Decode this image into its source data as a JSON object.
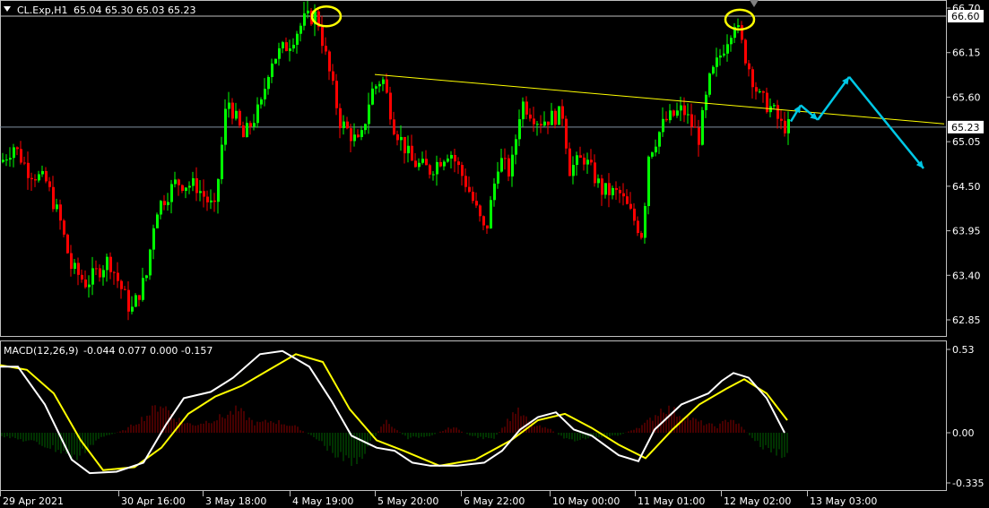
{
  "header": {
    "symbol": "CL.Exp,H1",
    "ohlc": "65.04 65.30 65.03 65.23"
  },
  "macd_header": {
    "label": "MACD(12,26,9)",
    "values": "-0.044 0.077 0.000 -0.157"
  },
  "price_axis": {
    "ticks": [
      "66.70",
      "66.15",
      "65.60",
      "65.05",
      "64.50",
      "63.95",
      "63.40",
      "62.85"
    ],
    "tick_values": [
      66.7,
      66.15,
      65.6,
      65.05,
      64.5,
      63.95,
      63.4,
      62.85
    ],
    "current_price": "65.23",
    "resistance_price": "66.60",
    "resistance_value": 66.6,
    "current_value": 65.23
  },
  "macd_axis": {
    "ticks": [
      "0.53",
      "0.00",
      "-0.335"
    ],
    "tick_values": [
      0.53,
      0.0,
      -0.335
    ]
  },
  "time_axis": {
    "labels": [
      "29 Apr 2021",
      "30 Apr 16:00",
      "3 May 18:00",
      "4 May 19:00",
      "5 May 20:00",
      "6 May 22:00",
      "10 May 00:00",
      "11 May 01:00",
      "12 May 02:00",
      "13 May 03:00"
    ]
  },
  "colors": {
    "background": "#000000",
    "bull": "#00ff00",
    "bear": "#ff0000",
    "grid_line": "#c0c0c0",
    "trendline": "#ffff00",
    "macd_line": "#ffffff",
    "signal_line": "#ffff00",
    "histogram_pos": "#8b0000",
    "histogram_neg": "#006400",
    "annotation_arrow": "#00c8e6",
    "circle": "#ffff00",
    "tag_bg": "#ffffff",
    "tag_text": "#000000"
  },
  "chart_data": {
    "type": "candlestick",
    "timeframe": "H1",
    "price_path": [
      [
        0,
        64.8
      ],
      [
        14,
        65.0
      ],
      [
        30,
        64.7
      ],
      [
        50,
        64.55
      ],
      [
        65,
        64.1
      ],
      [
        78,
        63.5
      ],
      [
        95,
        63.3
      ],
      [
        120,
        63.6
      ],
      [
        145,
        62.95
      ],
      [
        162,
        63.4
      ],
      [
        172,
        64.2
      ],
      [
        195,
        64.55
      ],
      [
        218,
        64.5
      ],
      [
        238,
        64.2
      ],
      [
        252,
        65.6
      ],
      [
        270,
        65.1
      ],
      [
        290,
        65.5
      ],
      [
        300,
        66.05
      ],
      [
        320,
        66.25
      ],
      [
        338,
        66.55
      ],
      [
        352,
        66.62
      ],
      [
        362,
        66.1
      ],
      [
        378,
        65.3
      ],
      [
        400,
        65.0
      ],
      [
        412,
        65.65
      ],
      [
        425,
        65.85
      ],
      [
        438,
        65.25
      ],
      [
        458,
        64.8
      ],
      [
        478,
        64.7
      ],
      [
        500,
        64.95
      ],
      [
        520,
        64.5
      ],
      [
        540,
        63.9
      ],
      [
        555,
        64.85
      ],
      [
        568,
        64.65
      ],
      [
        580,
        65.55
      ],
      [
        600,
        65.3
      ],
      [
        628,
        65.4
      ],
      [
        632,
        64.7
      ],
      [
        650,
        64.85
      ],
      [
        670,
        64.45
      ],
      [
        690,
        64.4
      ],
      [
        705,
        64.1
      ],
      [
        715,
        63.9
      ],
      [
        722,
        64.9
      ],
      [
        740,
        65.3
      ],
      [
        760,
        65.45
      ],
      [
        778,
        65.1
      ],
      [
        790,
        65.8
      ],
      [
        805,
        66.2
      ],
      [
        818,
        66.55
      ],
      [
        830,
        66.1
      ],
      [
        845,
        65.6
      ],
      [
        860,
        65.45
      ],
      [
        870,
        65.25
      ],
      [
        880,
        65.23
      ]
    ],
    "macd": [
      [
        0,
        0.42
      ],
      [
        20,
        0.42
      ],
      [
        50,
        0.18
      ],
      [
        80,
        -0.18
      ],
      [
        100,
        -0.27
      ],
      [
        130,
        -0.26
      ],
      [
        160,
        -0.2
      ],
      [
        185,
        0.05
      ],
      [
        205,
        0.22
      ],
      [
        235,
        0.26
      ],
      [
        260,
        0.35
      ],
      [
        290,
        0.5
      ],
      [
        315,
        0.52
      ],
      [
        345,
        0.42
      ],
      [
        370,
        0.2
      ],
      [
        392,
        -0.02
      ],
      [
        420,
        -0.1
      ],
      [
        440,
        -0.12
      ],
      [
        460,
        -0.2
      ],
      [
        480,
        -0.22
      ],
      [
        510,
        -0.22
      ],
      [
        540,
        -0.2
      ],
      [
        560,
        -0.12
      ],
      [
        580,
        0.02
      ],
      [
        600,
        0.1
      ],
      [
        620,
        0.13
      ],
      [
        640,
        0.02
      ],
      [
        660,
        -0.02
      ],
      [
        690,
        -0.15
      ],
      [
        712,
        -0.19
      ],
      [
        730,
        0.02
      ],
      [
        760,
        0.18
      ],
      [
        790,
        0.25
      ],
      [
        805,
        0.33
      ],
      [
        818,
        0.38
      ],
      [
        835,
        0.35
      ],
      [
        855,
        0.22
      ],
      [
        875,
        0.0
      ]
    ],
    "signal": [
      [
        0,
        0.43
      ],
      [
        30,
        0.4
      ],
      [
        60,
        0.25
      ],
      [
        90,
        -0.05
      ],
      [
        115,
        -0.25
      ],
      [
        150,
        -0.23
      ],
      [
        180,
        -0.1
      ],
      [
        210,
        0.12
      ],
      [
        240,
        0.23
      ],
      [
        270,
        0.3
      ],
      [
        300,
        0.4
      ],
      [
        330,
        0.5
      ],
      [
        360,
        0.45
      ],
      [
        390,
        0.15
      ],
      [
        420,
        -0.05
      ],
      [
        450,
        -0.12
      ],
      [
        490,
        -0.22
      ],
      [
        530,
        -0.18
      ],
      [
        570,
        -0.05
      ],
      [
        600,
        0.08
      ],
      [
        630,
        0.12
      ],
      [
        660,
        0.03
      ],
      [
        690,
        -0.08
      ],
      [
        720,
        -0.17
      ],
      [
        750,
        0.02
      ],
      [
        780,
        0.18
      ],
      [
        810,
        0.28
      ],
      [
        830,
        0.34
      ],
      [
        855,
        0.25
      ],
      [
        878,
        0.08
      ]
    ],
    "histogram": [
      [
        0,
        -0.02
      ],
      [
        40,
        -0.07
      ],
      [
        70,
        -0.13
      ],
      [
        85,
        -0.18
      ],
      [
        110,
        -0.04
      ],
      [
        140,
        0.02
      ],
      [
        165,
        0.12
      ],
      [
        180,
        0.2
      ],
      [
        195,
        0.1
      ],
      [
        215,
        0.05
      ],
      [
        245,
        0.1
      ],
      [
        265,
        0.15
      ],
      [
        285,
        0.06
      ],
      [
        305,
        0.08
      ],
      [
        330,
        0.04
      ],
      [
        355,
        -0.05
      ],
      [
        380,
        -0.18
      ],
      [
        395,
        -0.22
      ],
      [
        410,
        -0.1
      ],
      [
        430,
        0.08
      ],
      [
        455,
        -0.04
      ],
      [
        480,
        -0.02
      ],
      [
        505,
        0.04
      ],
      [
        525,
        -0.02
      ],
      [
        550,
        -0.05
      ],
      [
        575,
        0.15
      ],
      [
        595,
        0.05
      ],
      [
        615,
        0.02
      ],
      [
        635,
        -0.06
      ],
      [
        660,
        -0.03
      ],
      [
        690,
        -0.02
      ],
      [
        720,
        0.06
      ],
      [
        740,
        0.17
      ],
      [
        760,
        0.12
      ],
      [
        780,
        0.07
      ],
      [
        800,
        0.04
      ],
      [
        815,
        0.1
      ],
      [
        830,
        0.02
      ],
      [
        850,
        -0.1
      ],
      [
        875,
        -0.15
      ]
    ],
    "trendline": {
      "from": [
        418,
        65.88
      ],
      "to": [
        1053,
        65.27
      ]
    },
    "top_markers": [
      [
        364,
        66.62
      ],
      [
        825,
        66.58
      ]
    ],
    "projection_arrows": [
      [
        [
          882,
          65.3
        ],
        [
          893,
          65.5
        ]
      ],
      [
        [
          893,
          65.5
        ],
        [
          912,
          65.32
        ]
      ],
      [
        [
          912,
          65.32
        ],
        [
          947,
          65.85
        ]
      ],
      [
        [
          947,
          65.85
        ],
        [
          1030,
          64.72
        ]
      ]
    ],
    "x_label_positions": [
      0,
      132,
      226,
      323,
      418,
      514,
      613,
      708,
      804,
      900
    ]
  }
}
